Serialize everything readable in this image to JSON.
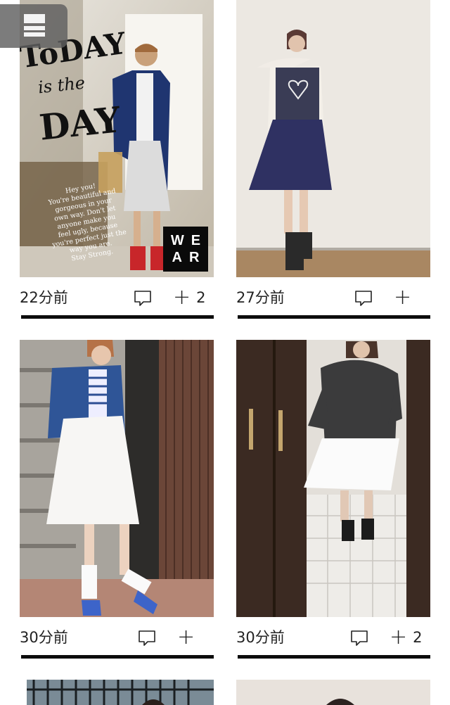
{
  "posts": [
    {
      "time": "22分前",
      "count": "2"
    },
    {
      "time": "27分前",
      "count": ""
    },
    {
      "time": "30分前",
      "count": ""
    },
    {
      "time": "30分前",
      "count": "2"
    }
  ],
  "photo_overlay": {
    "line1": "ToDAY",
    "line2": "is the",
    "line3": "DAY",
    "message": [
      "Hey you!",
      "You're beautiful and",
      "gorgeous in your",
      "own way. Don't let",
      "anyone make you",
      "feel ugly, because",
      "you're perfect just the",
      "way you are.",
      "Stay Strong."
    ]
  },
  "wear_logo": {
    "top": "WE",
    "bottom": "AR"
  },
  "icons": {
    "menu": "menu-icon",
    "comment": "comment-icon",
    "add": "plus-icon"
  },
  "colors": {
    "background": "#ffffff",
    "text": "#222222",
    "bar": "#0c0c0c",
    "menu_button": "#5f5f5f"
  }
}
